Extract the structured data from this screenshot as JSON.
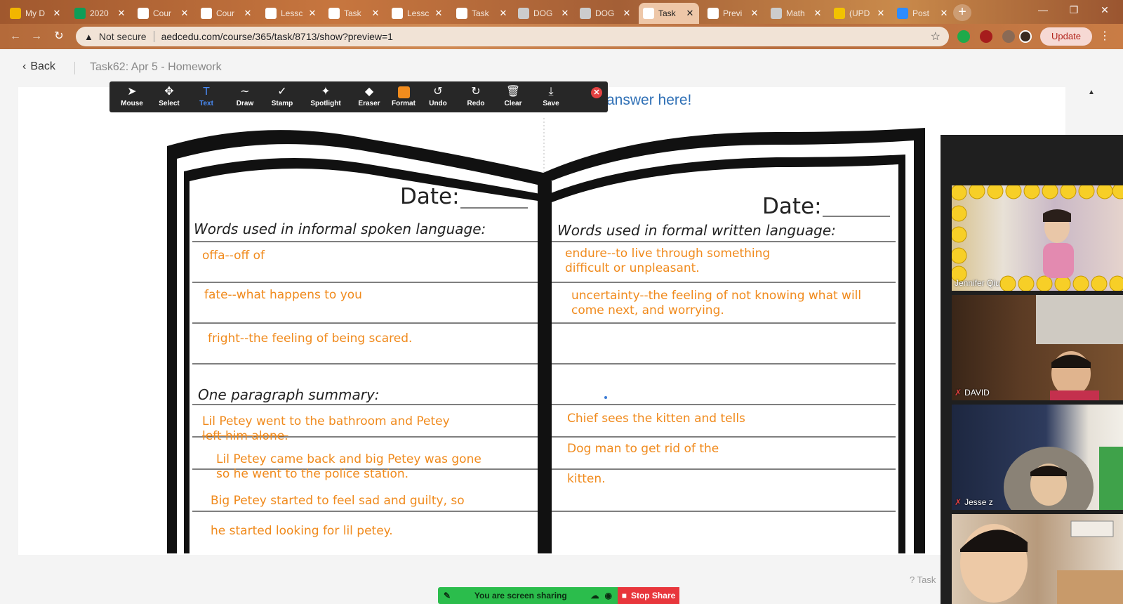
{
  "browser": {
    "tabs": [
      {
        "label": "My D",
        "icon": "google-drive-icon",
        "color": "#f2b600"
      },
      {
        "label": "2020",
        "icon": "google-sheets-icon",
        "color": "#0f9d58"
      },
      {
        "label": "Cour",
        "icon": "site-favicon-icon",
        "color": "#ffffff"
      },
      {
        "label": "Cour",
        "icon": "site-favicon-icon",
        "color": "#ffffff"
      },
      {
        "label": "Lessc",
        "icon": "site-favicon-icon",
        "color": "#ffffff"
      },
      {
        "label": "Task",
        "icon": "site-favicon-icon",
        "color": "#ffffff"
      },
      {
        "label": "Lessc",
        "icon": "site-favicon-icon",
        "color": "#ffffff"
      },
      {
        "label": "Task",
        "icon": "site-favicon-icon",
        "color": "#ffffff"
      },
      {
        "label": "DOG",
        "icon": "globe-icon",
        "color": "#cccccc"
      },
      {
        "label": "DOG",
        "icon": "globe-icon",
        "color": "#cccccc"
      },
      {
        "label": "Task",
        "icon": "site-favicon-icon",
        "color": "#ffffff",
        "active": true
      },
      {
        "label": "Previ",
        "icon": "site-favicon-icon",
        "color": "#ffffff"
      },
      {
        "label": "Math",
        "icon": "globe-icon",
        "color": "#cccccc"
      },
      {
        "label": "(UPD",
        "icon": "emoji-icon",
        "color": "#f2c200"
      },
      {
        "label": "Post",
        "icon": "zoom-icon",
        "color": "#2d8cff"
      }
    ],
    "new_tab_symbol": "+",
    "security_label": "Not secure",
    "url": "aedcedu.com/course/365/task/8713/show?preview=1",
    "update_label": "Update"
  },
  "page": {
    "back_label": "Back",
    "breadcrumb": "Task62: Apr 5 - Homework",
    "answer_prompt": "answer here!"
  },
  "annotation_toolbar": {
    "tools": [
      {
        "label": "Mouse",
        "icon": "cursor-icon",
        "glyph": "➤"
      },
      {
        "label": "Select",
        "icon": "move-icon",
        "glyph": "✥"
      },
      {
        "label": "Text",
        "icon": "text-icon",
        "glyph": "T",
        "active": true
      },
      {
        "label": "Draw",
        "icon": "squiggle-icon",
        "glyph": "∼"
      },
      {
        "label": "Stamp",
        "icon": "checkmark-icon",
        "glyph": "✓"
      },
      {
        "label": "Spotlight",
        "icon": "spotlight-icon",
        "glyph": "✦"
      },
      {
        "label": "Eraser",
        "icon": "eraser-icon",
        "glyph": "◆"
      },
      {
        "label": "Format",
        "icon": "format-swatch-icon",
        "glyph": ""
      },
      {
        "label": "Undo",
        "icon": "undo-icon",
        "glyph": "↺"
      },
      {
        "label": "Redo",
        "icon": "redo-icon",
        "glyph": "↻"
      },
      {
        "label": "Clear",
        "icon": "trash-icon",
        "glyph": "🗑"
      },
      {
        "label": "Save",
        "icon": "save-icon",
        "glyph": "⤓"
      }
    ],
    "close_symbol": "✕"
  },
  "worksheet": {
    "left": {
      "date_label": "Date:",
      "heading": "Words used in informal spoken language:",
      "entries": [
        "offa--off of",
        "fate--what happens to you",
        "fright--the feeling of being scared."
      ],
      "summary_heading": "One paragraph summary:",
      "summary": [
        [
          "Lil Petey went to the bathroom and Petey",
          "left him alone."
        ],
        [
          "Lil Petey came back and big Petey was gone",
          "so he went to the police station."
        ],
        [
          "Big Petey started to feel sad and guilty, so"
        ],
        [
          "he started looking for lil petey."
        ]
      ]
    },
    "right": {
      "date_label": "Date:",
      "heading": "Words used in formal written language:",
      "entries": [
        [
          "endure--to live through something",
          "difficult or unpleasant."
        ],
        [
          "uncertainty--the feeling of not knowing what will",
          "come next, and worrying."
        ]
      ],
      "summary": [
        "Chief sees the kitten and tells",
        "Dog man to get rid of the",
        "kitten."
      ]
    }
  },
  "video": {
    "participants": [
      {
        "name": "Jennifer Qiu",
        "muted": false
      },
      {
        "name": "DAVID",
        "muted": true
      },
      {
        "name": "Jesse z",
        "muted": true
      },
      {
        "name": "",
        "muted": false
      }
    ]
  },
  "share": {
    "status": "You are screen sharing",
    "stop_label": "Stop Share"
  },
  "help_label": "Task",
  "colors": {
    "annotation_orange": "#f08a1c",
    "link_blue": "#2e6fb5",
    "share_green": "#2bbd4c",
    "stop_red": "#e8363c"
  }
}
